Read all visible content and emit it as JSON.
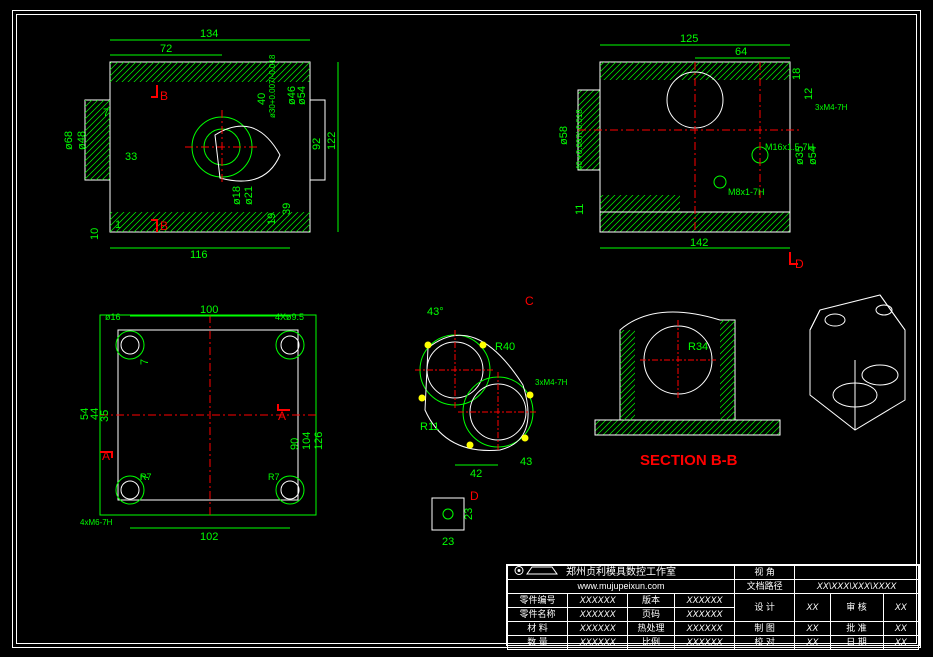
{
  "views": {
    "front": {
      "dims": {
        "w134": "134",
        "w72": "72",
        "h40": "40",
        "h122": "122",
        "h92": "92",
        "h39": "39",
        "h19": "19",
        "d68": "ø68",
        "d48": "ø48",
        "d54": "ø54",
        "d46": "ø46",
        "d21": "ø21",
        "d18": "ø18",
        "w33": "33",
        "w116": "116",
        "h10": "10",
        "cb": "1",
        "tol": "ø30+0.007/-0.018",
        "secB1": "B",
        "secB2": "B",
        "n7": "7"
      }
    },
    "right": {
      "dims": {
        "w125": "125",
        "w64": "64",
        "h18": "18",
        "h12": "12",
        "d58": "ø58",
        "tol40": "40 +0.007/-0.018",
        "h11": "11",
        "w142": "142",
        "d35": "ø35",
        "d54": "ø54",
        "m16": "M16x1.5-7H",
        "m8": "M8x1-7H",
        "m4": "3xM4-7H",
        "secD": "D"
      }
    },
    "top": {
      "dims": {
        "w100": "100",
        "w102": "102",
        "h54": "54",
        "h44": "44",
        "h35": "35",
        "h90": "90",
        "h104": "104",
        "h126": "126",
        "d16": "ø16",
        "holes": "4Xø9.5",
        "r7a": "R7",
        "r7b": "R7",
        "tap": "4xM6-7H",
        "secA1": "A",
        "secA2": "A",
        "n7": "7"
      }
    },
    "detailC": {
      "label": "C",
      "dims": {
        "a43": "43°",
        "r40": "R40",
        "m4": "3xM4-7H",
        "r11": "R11",
        "w42": "42",
        "w43": "43"
      }
    },
    "sectionBB": {
      "label": "SECTION B-B",
      "r34": "R34"
    },
    "detailD": {
      "label": "D",
      "w23": "23",
      "h23": "23"
    },
    "iso": {}
  },
  "titleblock": {
    "company": "郑州贞利模具数控工作室",
    "url": "www.mujupeixun.com",
    "rows": [
      {
        "k": "零件编号",
        "v": "XXXXXX",
        "k2": "版本",
        "v2": "XXXXXX"
      },
      {
        "k": "零件名称",
        "v": "XXXXXX",
        "k2": "页码",
        "v2": "XXXXXX"
      },
      {
        "k": "材 料",
        "v": "XXXXXX",
        "k2": "热处理",
        "v2": "XXXXXX"
      },
      {
        "k": "数 量",
        "v": "XXXXXX",
        "k2": "比例",
        "v2": "XXXXXX"
      }
    ],
    "proj": "视 角",
    "route": "文档路径",
    "routev": "XX\\XXX\\XXX\\XXXX",
    "sign": [
      {
        "k": "设 计",
        "v": "XX",
        "k2": "审 核",
        "v2": "XX"
      },
      {
        "k": "制 图",
        "v": "XX",
        "k2": "批 准",
        "v2": "XX"
      },
      {
        "k": "校 对",
        "v": "XX",
        "k2": "日 期",
        "v2": "XX"
      }
    ]
  }
}
